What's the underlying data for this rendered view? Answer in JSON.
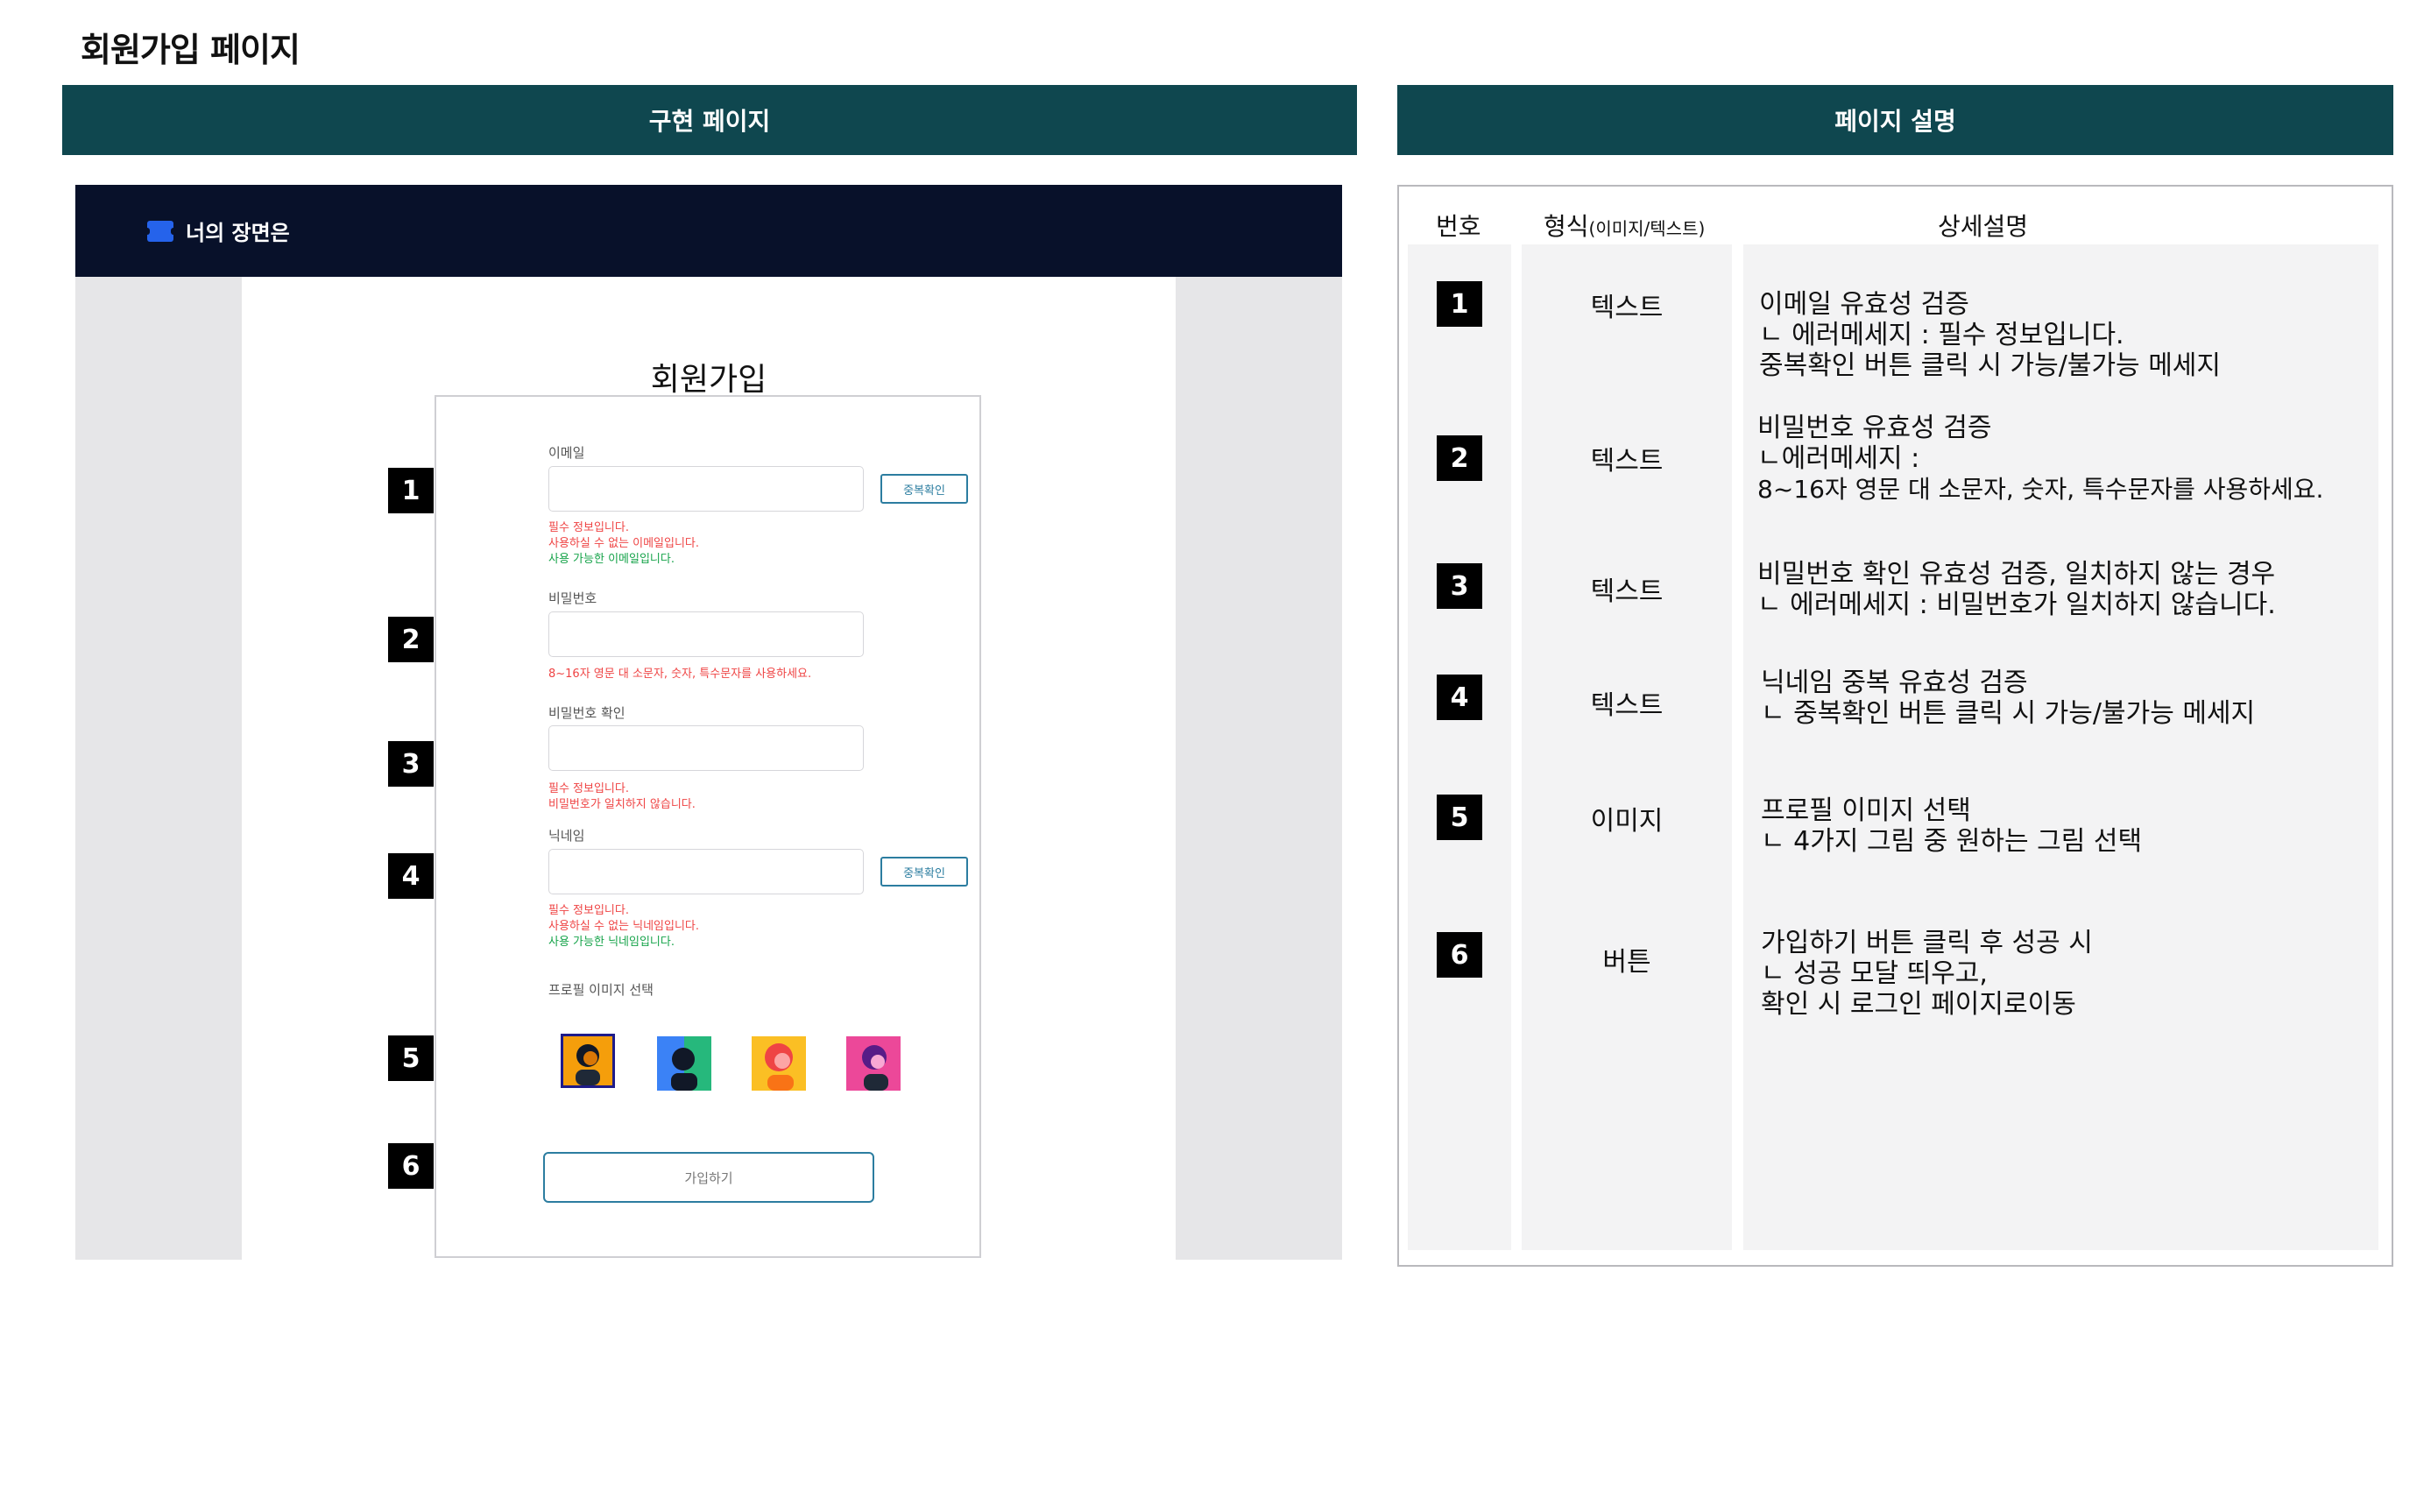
{
  "page_title": "회원가입 페이지",
  "left_header": "구현 페이지",
  "right_header": "페이지 설명",
  "mock": {
    "brand": "너의 장면은",
    "signup_title": "회원가입",
    "email_label": "이메일",
    "email_check_button": "중복확인",
    "email_messages": [
      "필수 정보입니다.",
      "사용하실 수 없는 이메일입니다.",
      "사용 가능한 이메일입니다."
    ],
    "password_label": "비밀번호",
    "password_message": "8~16자 영문 대 소문자, 숫자, 특수문자를 사용하세요.",
    "password_confirm_label": "비밀번호 확인",
    "password_confirm_messages": [
      "필수 정보입니다.",
      "비밀번호가 일치하지 않습니다."
    ],
    "nickname_label": "닉네임",
    "nickname_check_button": "중복확인",
    "nickname_messages": [
      "필수 정보입니다.",
      "사용하실 수 없는 닉네임입니다.",
      "사용 가능한 닉네임입니다."
    ],
    "profile_label": "프로필 이미지 선택",
    "avatars": [
      "avatar-dark-face-orange-bg",
      "avatar-green-face-blue-bg",
      "avatar-orange-hair-yellow-bg",
      "avatar-dark-hair-pink-bg"
    ],
    "submit_button": "가입하기"
  },
  "markers": [
    "1",
    "2",
    "3",
    "4",
    "5",
    "6"
  ],
  "table": {
    "col_number": "번호",
    "col_type": "형식",
    "col_type_sub": "(이미지/텍스트)",
    "col_detail": "상세설명",
    "rows": [
      {
        "number": "1",
        "type": "텍스트",
        "lines": [
          "이메일 유효성 검증",
          "ㄴ 에러메세지 : 필수 정보입니다.",
          "중복확인 버튼 클릭 시 가능/불가능 메세지"
        ]
      },
      {
        "number": "2",
        "type": "텍스트",
        "lines": [
          "비밀번호 유효성 검증",
          "ㄴ에러메세지 :",
          "8~16자 영문 대 소문자, 숫자, 특수문자를 사용하세요."
        ]
      },
      {
        "number": "3",
        "type": "텍스트",
        "lines": [
          "비밀번호 확인 유효성 검증, 일치하지 않는 경우",
          "ㄴ 에러메세지 : 비밀번호가 일치하지 않습니다."
        ]
      },
      {
        "number": "4",
        "type": "텍스트",
        "lines": [
          "닉네임 중복 유효성 검증",
          "ㄴ 중복확인 버튼 클릭 시 가능/불가능 메세지"
        ]
      },
      {
        "number": "5",
        "type": "이미지",
        "lines": [
          "프로필 이미지 선택",
          "ㄴ 4가지 그림 중 원하는 그림 선택"
        ]
      },
      {
        "number": "6",
        "type": "버튼",
        "lines": [
          "가입하기 버튼 클릭 후 성공 시",
          "ㄴ 성공 모달 띄우고,",
          "확인 시 로그인 페이지로이동"
        ]
      }
    ]
  }
}
